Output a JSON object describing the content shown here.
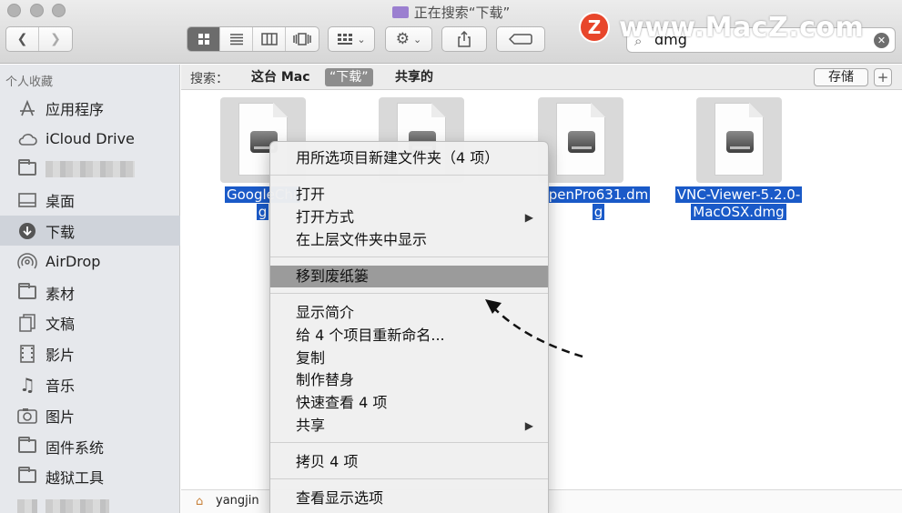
{
  "window": {
    "title": "正在搜索“下载”"
  },
  "toolbar": {
    "back_icon": "chevron-left-icon",
    "forward_icon": "chevron-right-icon",
    "view_modes": [
      "icon-view",
      "list-view",
      "column-view",
      "cover-flow-view"
    ],
    "active_view": "icon-view",
    "search_value": "dmg",
    "search_clear_icon": "clear-icon"
  },
  "watermark": {
    "logo_letter": "Z",
    "text": "www.MacZ.com"
  },
  "sidebar": {
    "heading": "个人收藏",
    "items": [
      {
        "label": "应用程序",
        "icon": "applications-icon"
      },
      {
        "label": "iCloud Drive",
        "icon": "cloud-icon"
      },
      {
        "label": "",
        "icon": "folder-icon",
        "blurred": true
      },
      {
        "label": "桌面",
        "icon": "desktop-icon"
      },
      {
        "label": "下载",
        "icon": "download-icon",
        "selected": true
      },
      {
        "label": "AirDrop",
        "icon": "airdrop-icon"
      },
      {
        "label": "素材",
        "icon": "folder-icon"
      },
      {
        "label": "文稿",
        "icon": "documents-icon"
      },
      {
        "label": "影片",
        "icon": "movies-icon"
      },
      {
        "label": "音乐",
        "icon": "music-icon"
      },
      {
        "label": "图片",
        "icon": "pictures-icon"
      },
      {
        "label": "固件系统",
        "icon": "folder-icon"
      },
      {
        "label": "越狱工具",
        "icon": "folder-icon"
      },
      {
        "label": "",
        "icon": "folder-icon",
        "blurred": true
      }
    ]
  },
  "scope": {
    "label": "搜索：",
    "options": [
      "这台 Mac",
      "“下载”",
      "共享的"
    ],
    "active": 1,
    "save_label": "存储",
    "add_label": "+"
  },
  "files": [
    {
      "line1": "GoogleChr",
      "line2": "g"
    },
    {
      "line1": "",
      "line2": ""
    },
    {
      "line1": "penPro631.dm",
      "line2": "g"
    },
    {
      "line1": "VNC-Viewer-5.2.0-",
      "line2": "MacOSX.dmg"
    }
  ],
  "pathbar": {
    "user": "yangjin"
  },
  "context_menu": {
    "groups": [
      [
        "用所选项目新建文件夹（4 项）"
      ],
      [
        "打开",
        "打开方式",
        "在上层文件夹中显示"
      ],
      [
        "移到废纸篓"
      ],
      [
        "显示简介",
        "给 4 个项目重新命名...",
        "复制",
        "制作替身",
        "快速查看 4 项",
        "共享"
      ],
      [
        "拷贝 4 项"
      ],
      [
        "查看显示选项"
      ]
    ],
    "highlighted": "移到废纸篓",
    "submenu_items": [
      "打开方式",
      "共享"
    ]
  },
  "colors": {
    "selection_blue": "#1a5ac8",
    "menu_highlight": "#9b9b9b",
    "sidebar_bg": "#e6e8ec"
  }
}
